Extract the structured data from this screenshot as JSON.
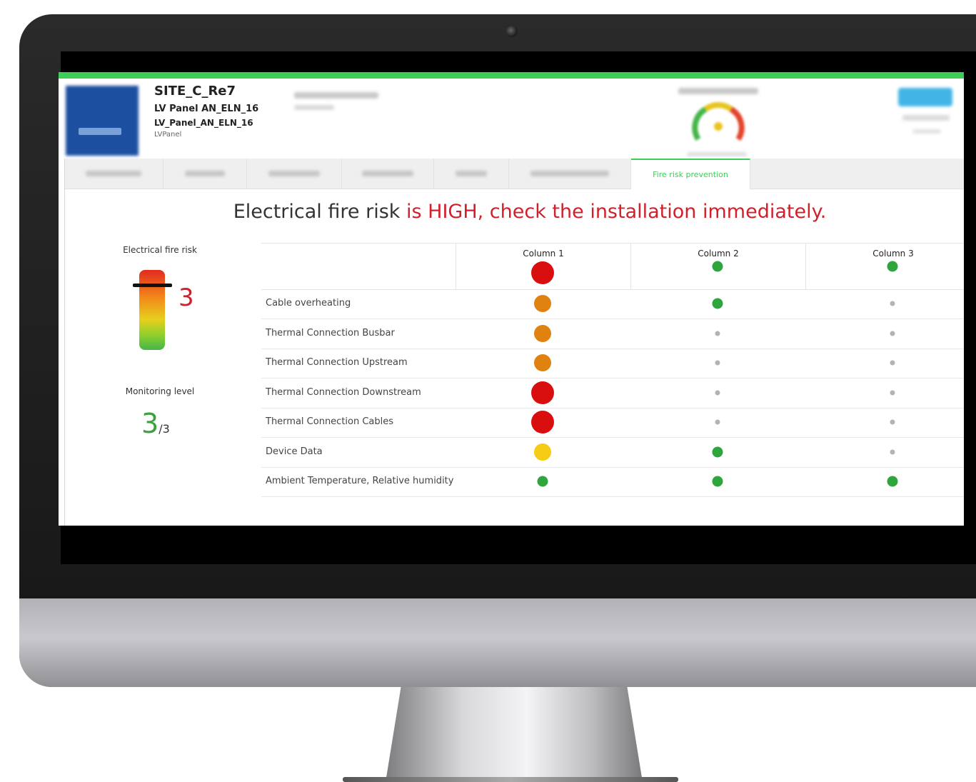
{
  "header": {
    "site": "SITE_C_Re7",
    "panel_name": "LV Panel AN_ELN_16",
    "panel_id": "LV_Panel_AN_ELN_16",
    "panel_type": "LVPanel"
  },
  "tabs": {
    "active_label": "Fire risk prevention"
  },
  "headline": {
    "prefix": "Electrical fire risk ",
    "warning": "is HIGH, check the installation immediately."
  },
  "risk": {
    "label": "Electrical fire risk",
    "value": "3"
  },
  "monitoring": {
    "label": "Monitoring level",
    "value": "3",
    "max": "/3"
  },
  "status_colors": {
    "red": "#d90f0f",
    "orange": "#e0820f",
    "yellow": "#f5cc13",
    "green": "#2fa63d",
    "grey": "#b3b3b3"
  },
  "table": {
    "columns": [
      {
        "label": "Column 1",
        "status": "red"
      },
      {
        "label": "Column 2",
        "status": "green"
      },
      {
        "label": "Column 3",
        "status": "green"
      }
    ],
    "rows": [
      {
        "label": "Cable overheating",
        "status": [
          "orange",
          "green",
          "grey"
        ]
      },
      {
        "label": "Thermal Connection Busbar",
        "status": [
          "orange",
          "grey",
          "grey"
        ]
      },
      {
        "label": "Thermal Connection Upstream",
        "status": [
          "orange",
          "grey",
          "grey"
        ]
      },
      {
        "label": "Thermal Connection Downstream",
        "status": [
          "red",
          "grey",
          "grey"
        ]
      },
      {
        "label": "Thermal Connection Cables",
        "status": [
          "red",
          "grey",
          "grey"
        ]
      },
      {
        "label": "Device Data",
        "status": [
          "yellow",
          "green",
          "grey"
        ]
      },
      {
        "label": "Ambient Temperature, Relative humidity",
        "status": [
          "green",
          "green",
          "green"
        ]
      }
    ]
  }
}
